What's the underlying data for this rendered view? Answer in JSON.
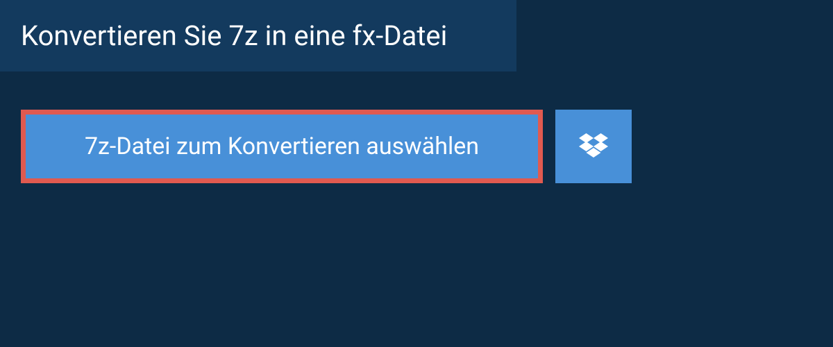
{
  "header": {
    "title": "Konvertieren Sie 7z in eine fx-Datei"
  },
  "buttons": {
    "select_file_label": "7z-Datei zum Konvertieren auswählen"
  },
  "colors": {
    "background": "#0d2b45",
    "header_bg": "#133a5e",
    "button_bg": "#4890d8",
    "highlight_border": "#e05a50",
    "text": "#ffffff"
  }
}
